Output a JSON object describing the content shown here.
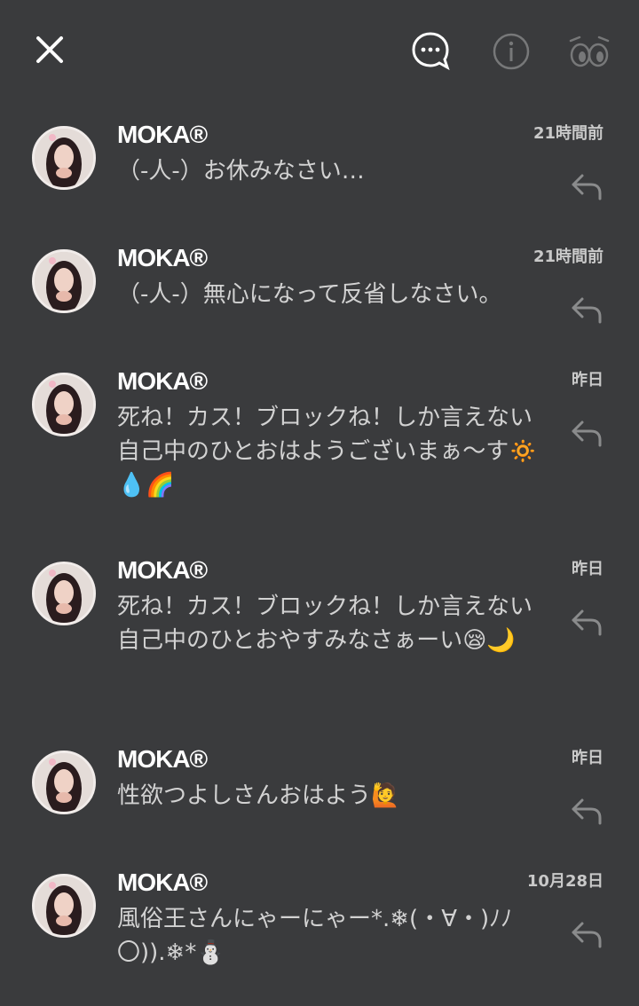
{
  "toolbar": {
    "close_icon": "close-icon",
    "chat_icon": "speech-bubble-ellipsis-icon",
    "info_icon": "info-icon",
    "eyes_icon": "eyes-icon"
  },
  "messages": [
    {
      "name": "MOKA®",
      "time": "21時間前",
      "text": "（-人-）お休みなさい…"
    },
    {
      "name": "MOKA®",
      "time": "21時間前",
      "text": "（-人-）無心になって反省しなさい。"
    },
    {
      "name": "MOKA®",
      "time": "昨日",
      "text": "死ね！カス！ブロックね！しか言えない自己中のひとおはようございまぁ〜す🔅💧🌈"
    },
    {
      "name": "MOKA®",
      "time": "昨日",
      "text": "死ね！カス！ブロックね！しか言えない自己中のひとおやすみなさぁーい😪🌙"
    },
    {
      "name": "MOKA®",
      "time": "昨日",
      "text": "性欲つよしさんおはよう🙋"
    },
    {
      "name": "MOKA®",
      "time": "10月28日",
      "text": "風俗王さんにゃーにゃー*.❄(・∀・)ﾉﾉ〇)).❄*⛄"
    }
  ]
}
